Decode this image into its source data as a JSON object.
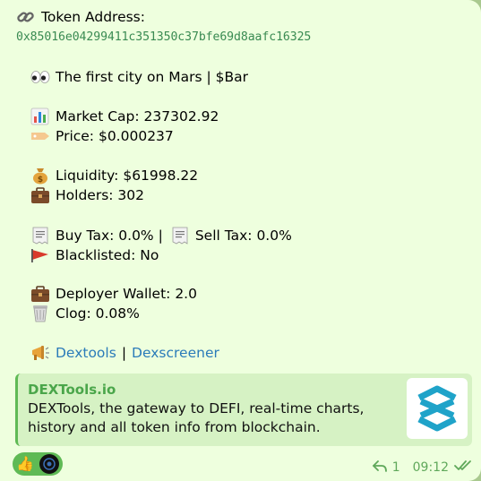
{
  "message": {
    "token_address_label": "Token Address:",
    "token_address": "0x85016e04299411c351350c37bfe69d8aafc16325",
    "token_name": "The first city on Mars | $Bar",
    "market_cap": "Market Cap: 237302.92",
    "price": "Price: $0.000237",
    "liquidity": "Liquidity: $61998.22",
    "holders": "Holders: 302",
    "buy_tax": "Buy Tax: 0.0% |",
    "sell_tax": "Sell Tax: 0.0%",
    "blacklisted": "Blacklisted: No",
    "deployer_wallet": "Deployer Wallet: 2.0",
    "clog": "Clog: 0.08%",
    "link_dextools": "Dextools",
    "link_separator": "|",
    "link_dexscreener": "Dexscreener"
  },
  "preview": {
    "site_name": "DEXTools.io",
    "description": "DEXTools, the gateway to DEFI, real-time charts, history and all token info from blockchain."
  },
  "reactions": {
    "emoji": "👍"
  },
  "meta": {
    "reply_count": "1",
    "time": "09:12"
  },
  "icons": {
    "link": "link-icon",
    "eyes": "eyes-icon",
    "chart": "bar-chart-icon",
    "price": "price-tag-icon",
    "money": "money-bag-icon",
    "briefcase": "briefcase-icon",
    "receipt": "receipt-icon",
    "flag": "red-flag-icon",
    "trash": "wastebasket-icon",
    "megaphone": "megaphone-icon",
    "reply": "reply-arrow-icon",
    "read": "double-check-icon"
  },
  "colors": {
    "bubble": "#eeffde",
    "background": "#a9c98f",
    "address": "#3a8a52",
    "link": "#2b7bb9",
    "accent": "#5fba55"
  }
}
